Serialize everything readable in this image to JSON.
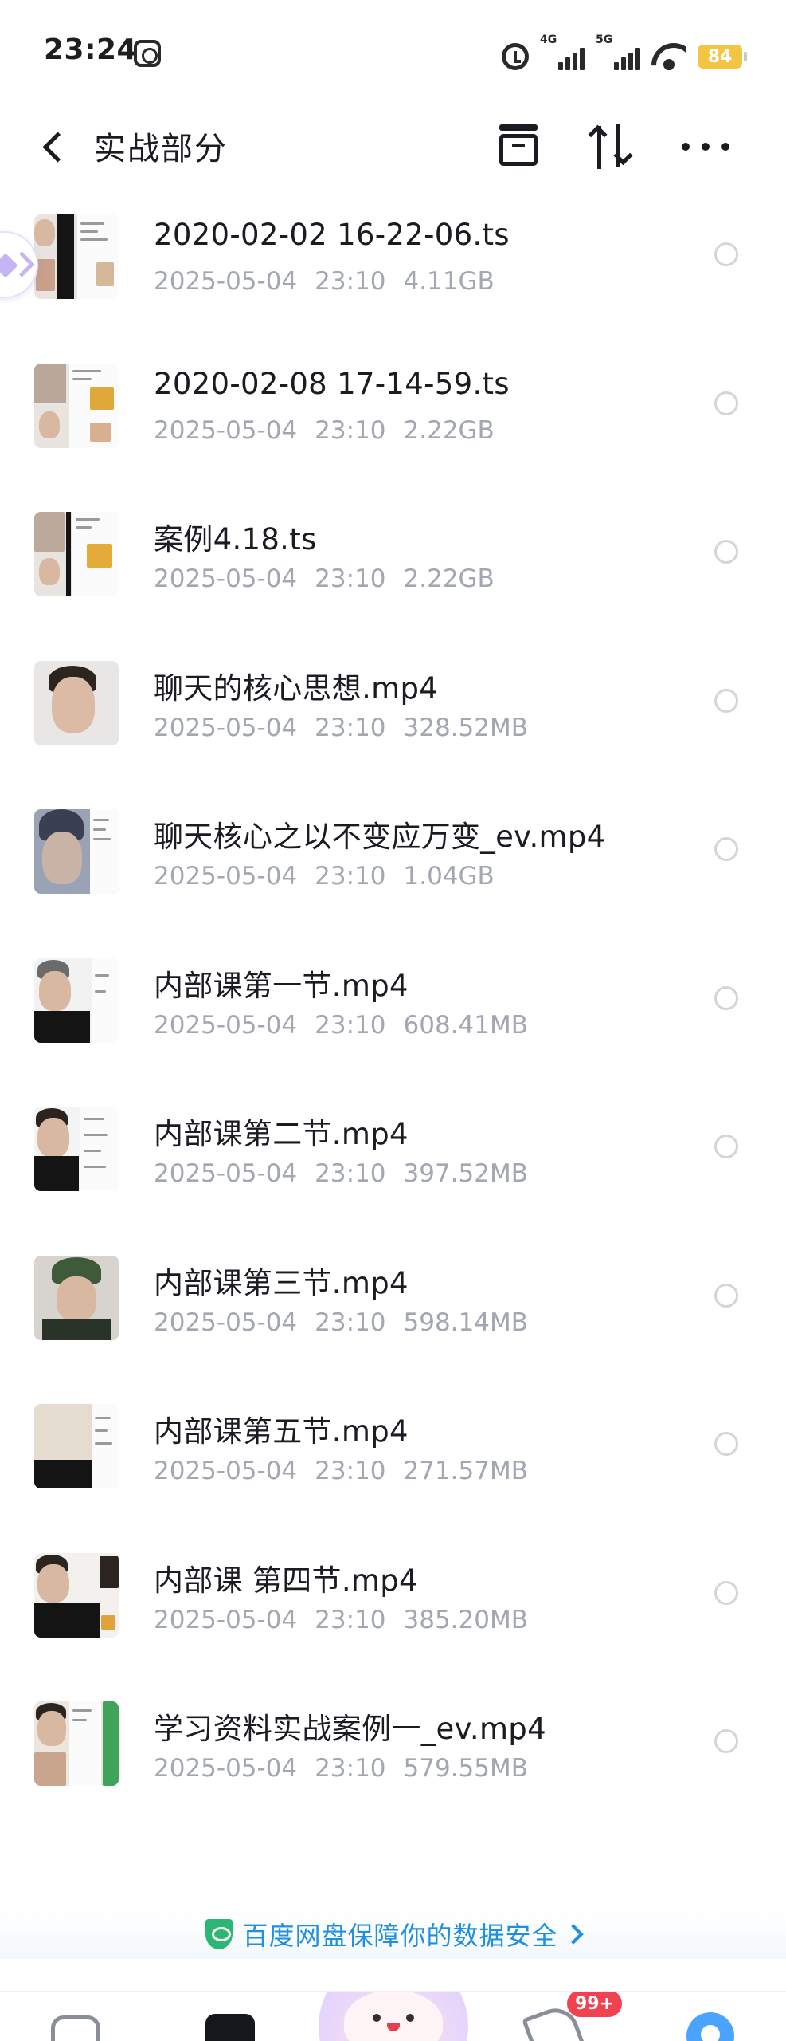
{
  "status_bar": {
    "time": "23:24",
    "net1": "4G",
    "net2": "5G",
    "battery": "84"
  },
  "header": {
    "title": "实战部分",
    "icons": [
      "back-arrow-icon",
      "archive-icon",
      "sort-icon",
      "more-icon"
    ]
  },
  "files": [
    {
      "name": "2020-02-02 16-22-06.ts",
      "date": "2025-05-04",
      "time": "23:10",
      "size": "4.11GB"
    },
    {
      "name": "2020-02-08 17-14-59.ts",
      "date": "2025-05-04",
      "time": "23:10",
      "size": "2.22GB"
    },
    {
      "name": "案例4.18.ts",
      "date": "2025-05-04",
      "time": "23:10",
      "size": "2.22GB"
    },
    {
      "name": "聊天的核心思想.mp4",
      "date": "2025-05-04",
      "time": "23:10",
      "size": "328.52MB"
    },
    {
      "name": "聊天核心之以不变应万变_ev.mp4",
      "date": "2025-05-04",
      "time": "23:10",
      "size": "1.04GB"
    },
    {
      "name": "内部课第一节.mp4",
      "date": "2025-05-04",
      "time": "23:10",
      "size": "608.41MB"
    },
    {
      "name": "内部课第二节.mp4",
      "date": "2025-05-04",
      "time": "23:10",
      "size": "397.52MB"
    },
    {
      "name": "内部课第三节.mp4",
      "date": "2025-05-04",
      "time": "23:10",
      "size": "598.14MB"
    },
    {
      "name": "内部课第五节.mp4",
      "date": "2025-05-04",
      "time": "23:10",
      "size": "271.57MB"
    },
    {
      "name": "内部课  第四节.mp4",
      "date": "2025-05-04",
      "time": "23:10",
      "size": "385.20MB"
    },
    {
      "name": "学习资料实战案例一_ev.mp4",
      "date": "2025-05-04",
      "time": "23:10",
      "size": "579.55MB"
    }
  ],
  "security_banner": {
    "text": "百度网盘保障你的数据安全"
  },
  "bottom_nav": {
    "badge": "99+"
  },
  "colors": {
    "accent_blue": "#1f8fe0",
    "meta_gray": "#a3a7b2",
    "badge_red": "#f2414f",
    "battery_yellow": "#f4c542",
    "shield_green": "#2bb673"
  }
}
